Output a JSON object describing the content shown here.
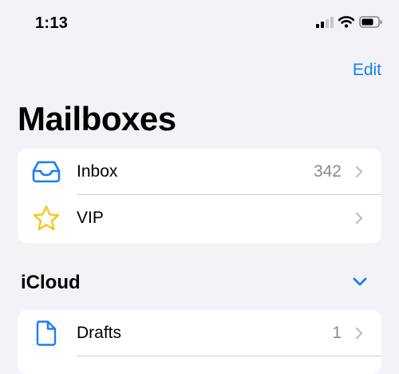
{
  "status_bar": {
    "time": "1:13",
    "icons": [
      "cellular-signal-icon",
      "wifi-icon",
      "battery-icon"
    ]
  },
  "header": {
    "edit_label": "Edit",
    "title": "Mailboxes"
  },
  "mailboxes": [
    {
      "label": "Inbox",
      "count": "342",
      "icon": "inbox-tray-icon"
    },
    {
      "label": "VIP",
      "count": "",
      "icon": "star-icon"
    }
  ],
  "icloud": {
    "title": "iCloud",
    "expanded": true,
    "items": [
      {
        "label": "Drafts",
        "count": "1",
        "icon": "document-icon"
      }
    ]
  },
  "colors": {
    "accent": "#1a7ff0",
    "star": "#f5c518",
    "background": "#f2f2f7",
    "secondary_text": "#8a8a8e"
  }
}
